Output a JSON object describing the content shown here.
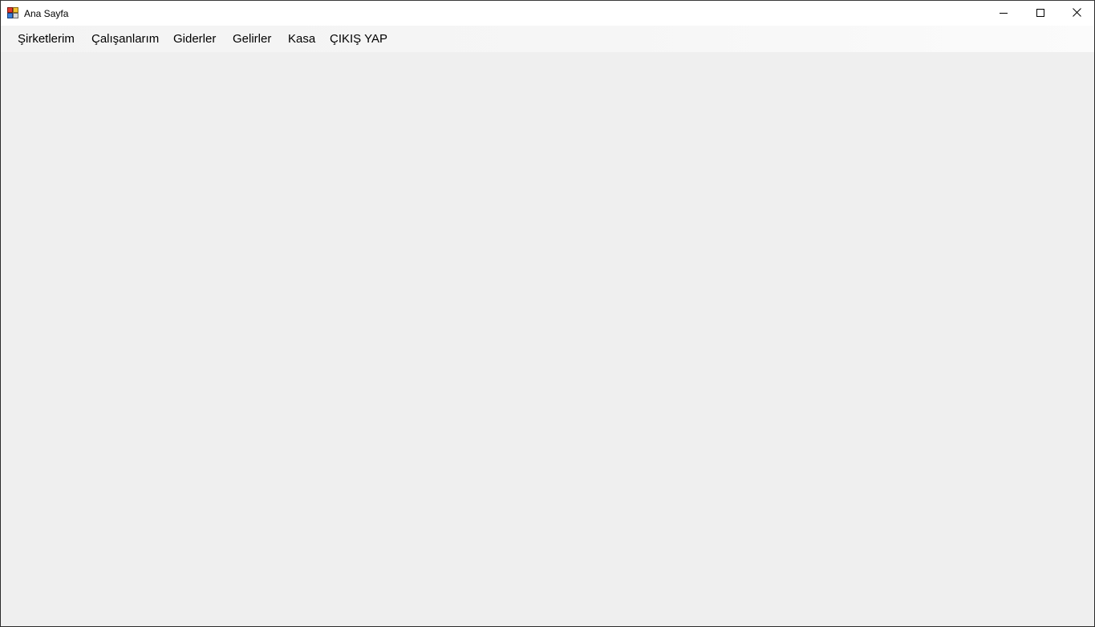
{
  "window": {
    "title": "Ana Sayfa",
    "controls": {
      "minimize_icon": "minimize-icon",
      "maximize_icon": "maximize-icon",
      "close_icon": "close-icon"
    }
  },
  "menu": {
    "items": [
      {
        "label": "Şirketlerim"
      },
      {
        "label": "Çalışanlarım"
      },
      {
        "label": "Giderler"
      },
      {
        "label": "Gelirler"
      },
      {
        "label": "Kasa"
      },
      {
        "label": "ÇIKIŞ YAP"
      }
    ]
  },
  "colors": {
    "titlebar_bg": "#ffffff",
    "menubar_bg": "#f5f5f5",
    "client_bg": "#efefef",
    "text": "#000000"
  }
}
